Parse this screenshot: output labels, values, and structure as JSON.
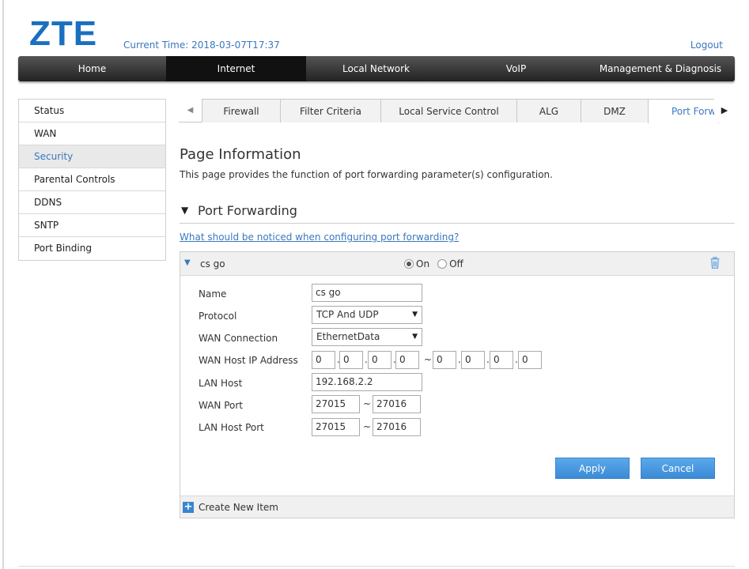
{
  "brand": {
    "logo": "ZTE",
    "accent": "#1a6fc0",
    "link_color": "#3a78bf"
  },
  "header": {
    "current_time": "Current Time: 2018-03-07T17:37",
    "logout": "Logout"
  },
  "topnav": [
    {
      "label": "Home",
      "active": false
    },
    {
      "label": "Internet",
      "active": true
    },
    {
      "label": "Local Network",
      "active": false
    },
    {
      "label": "VoIP",
      "active": false
    },
    {
      "label": "Management & Diagnosis",
      "active": false
    }
  ],
  "sidebar": {
    "items": [
      {
        "label": "Status",
        "active": false
      },
      {
        "label": "WAN",
        "active": false
      },
      {
        "label": "Security",
        "active": true
      },
      {
        "label": "Parental Controls",
        "active": false
      },
      {
        "label": "DDNS",
        "active": false
      },
      {
        "label": "SNTP",
        "active": false
      },
      {
        "label": "Port Binding",
        "active": false
      }
    ]
  },
  "tabs": {
    "left_icon": "triangle-left-icon",
    "right_icon": "triangle-right-icon",
    "items": [
      {
        "label": "Firewall",
        "active": false
      },
      {
        "label": "Filter Criteria",
        "active": false
      },
      {
        "label": "Local Service Control",
        "active": false
      },
      {
        "label": "ALG",
        "active": false
      },
      {
        "label": "DMZ",
        "active": false
      },
      {
        "label": "Port Forw",
        "active": true
      }
    ]
  },
  "page": {
    "title": "Page Information",
    "description": "This page provides the function of port forwarding parameter(s) configuration."
  },
  "section": {
    "title": "Port Forwarding",
    "help_link": "What should be noticed when configuring port forwarding?"
  },
  "rule": {
    "name": "cs go",
    "on_label": "On",
    "off_label": "Off",
    "state": "On",
    "form": {
      "name_label": "Name",
      "name_value": "cs go",
      "protocol_label": "Protocol",
      "protocol_value": "TCP And UDP",
      "wan_connection_label": "WAN Connection",
      "wan_connection_value": "EthernetData",
      "wan_host_ip_label": "WAN Host IP Address",
      "wan_host_ip_start": [
        "0",
        "0",
        "0",
        "0"
      ],
      "wan_host_ip_end": [
        "0",
        "0",
        "0",
        "0"
      ],
      "dot": ".",
      "tilde": "~",
      "lan_host_label": "LAN Host",
      "lan_host_value": "192.168.2.2",
      "wan_port_label": "WAN Port",
      "wan_port_start": "27015",
      "wan_port_end": "27016",
      "lan_host_port_label": "LAN Host Port",
      "lan_host_port_start": "27015",
      "lan_host_port_end": "27016"
    },
    "apply_label": "Apply",
    "cancel_label": "Cancel"
  },
  "footer": {
    "create_new_item": "Create New Item"
  }
}
